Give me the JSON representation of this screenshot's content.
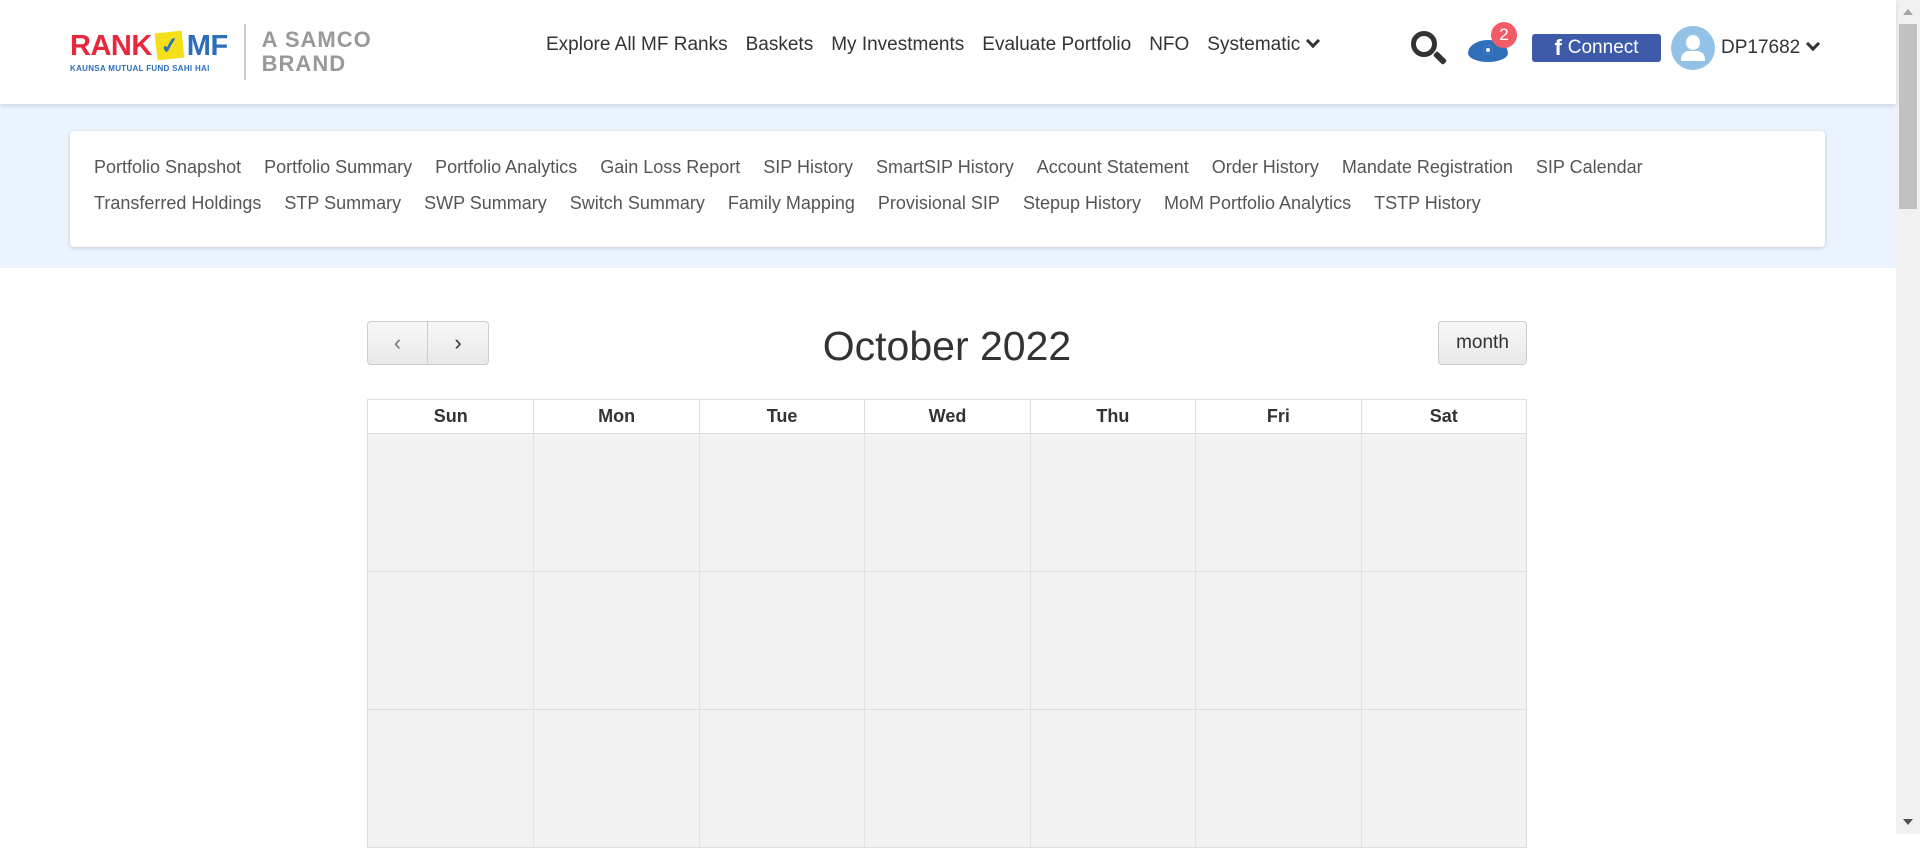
{
  "header": {
    "logo": {
      "rank": "RANK",
      "mf": "MF",
      "tagline": "KAUNSA MUTUAL FUND SAHI HAI",
      "brand_line1": "A SAMCO",
      "brand_line2": "BRAND"
    },
    "nav": [
      "Explore All MF Ranks",
      "Baskets",
      "My Investments",
      "Evaluate Portfolio",
      "NFO",
      "Systematic"
    ],
    "watchlist_count": "2",
    "connect_label": "Connect",
    "user_id": "DP17682"
  },
  "submenu": [
    "Portfolio Snapshot",
    "Portfolio Summary",
    "Portfolio Analytics",
    "Gain Loss Report",
    "SIP History",
    "SmartSIP History",
    "Account Statement",
    "Order History",
    "Mandate Registration",
    "SIP Calendar",
    "Transferred Holdings",
    "STP Summary",
    "SWP Summary",
    "Switch Summary",
    "Family Mapping",
    "Provisional SIP",
    "Stepup History",
    "MoM Portfolio Analytics",
    "TSTP History"
  ],
  "calendar": {
    "title": "October 2022",
    "prev": "‹",
    "next": "›",
    "view_button": "month",
    "days": [
      "Sun",
      "Mon",
      "Tue",
      "Wed",
      "Thu",
      "Fri",
      "Sat"
    ]
  }
}
